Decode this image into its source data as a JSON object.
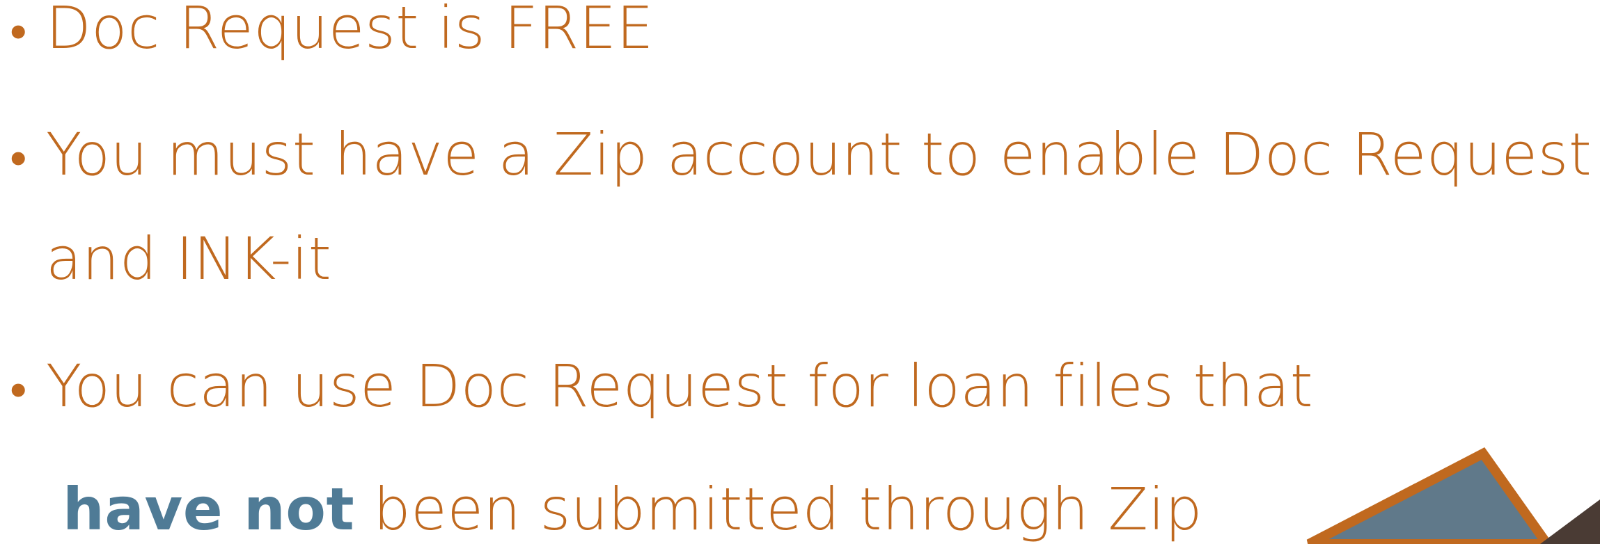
{
  "bullets": [
    {
      "text": "Doc Request is FREE"
    },
    {
      "text": "You must have a Zip account to enable Doc Request",
      "continuation": "and INK-it"
    },
    {
      "text": "You can use Doc Request for loan files that",
      "continuation_emphasis": "have not",
      "continuation_rest": " been submitted through Zip"
    }
  ],
  "bullet_glyph": "•",
  "colors": {
    "text": "#c0691f",
    "emphasis": "#4f7b96",
    "decor_fill": "#60798a",
    "decor_border": "#c0691f",
    "decor_dark": "#4a3b34"
  }
}
